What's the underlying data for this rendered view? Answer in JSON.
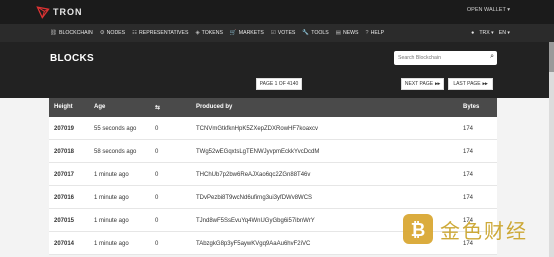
{
  "topbar": {
    "logo_text": "TRON",
    "open_wallet": "OPEN WALLET ▾"
  },
  "nav": {
    "items": [
      {
        "icon": "⛓",
        "label": "BLOCKCHAIN"
      },
      {
        "icon": "⚙",
        "label": "NODES"
      },
      {
        "icon": "☷",
        "label": "REPRESENTATIVES"
      },
      {
        "icon": "◈",
        "label": "TOKENS"
      },
      {
        "icon": "🛒",
        "label": "MARKETS"
      },
      {
        "icon": "☑",
        "label": "VOTES"
      },
      {
        "icon": "🔧",
        "label": "TOOLS"
      },
      {
        "icon": "▤",
        "label": "NEWS"
      },
      {
        "icon": "?",
        "label": "HELP"
      }
    ],
    "currency": "TRX ▾",
    "language": "EN ▾"
  },
  "page": {
    "title": "BLOCKS"
  },
  "search": {
    "placeholder": "Search Blockchain"
  },
  "paging": {
    "indicator": "PAGE 1 OF 4140",
    "next": "NEXT PAGE",
    "last": "LAST PAGE"
  },
  "table": {
    "headers": {
      "height": "Height",
      "age": "Age",
      "tx_icon": "⇆",
      "producer": "Produced by",
      "bytes": "Bytes"
    },
    "rows": [
      {
        "height": "207019",
        "age": "55 seconds ago",
        "tx": "0",
        "producer": "TCNVmGtkfknHpK5ZXepZDXRowHF7koaxcv",
        "bytes": "174"
      },
      {
        "height": "207018",
        "age": "58 seconds ago",
        "tx": "0",
        "producer": "TWg52wEGqxtsLgTENWJyvpmEckkYvcDcdM",
        "bytes": "174"
      },
      {
        "height": "207017",
        "age": "1 minute ago",
        "tx": "0",
        "producer": "THChUb7p2bw6ReAJXao6qc2ZGn88T46v",
        "bytes": "174"
      },
      {
        "height": "207016",
        "age": "1 minute ago",
        "tx": "0",
        "producer": "TDvPezbi8T9wcNd6ufirng3ui3yfDWv8WCS",
        "bytes": "174"
      },
      {
        "height": "207015",
        "age": "1 minute ago",
        "tx": "0",
        "producer": "TJnd8wF5SsEvuYq4WnUGyGbg6i57ibnWrY",
        "bytes": "174"
      },
      {
        "height": "207014",
        "age": "1 minute ago",
        "tx": "0",
        "producer": "TAbzgkG8p3yF5aywKVgq9AaAu6hvF2iVC",
        "bytes": "174"
      }
    ]
  },
  "watermark": {
    "text": "金色财经"
  },
  "colors": {
    "topbar": "#1b1b1b",
    "navbar": "#2b2b2b",
    "table_header": "#4a4a4a",
    "brand_red": "#c0392b",
    "watermark_gold": "#c9a227"
  }
}
